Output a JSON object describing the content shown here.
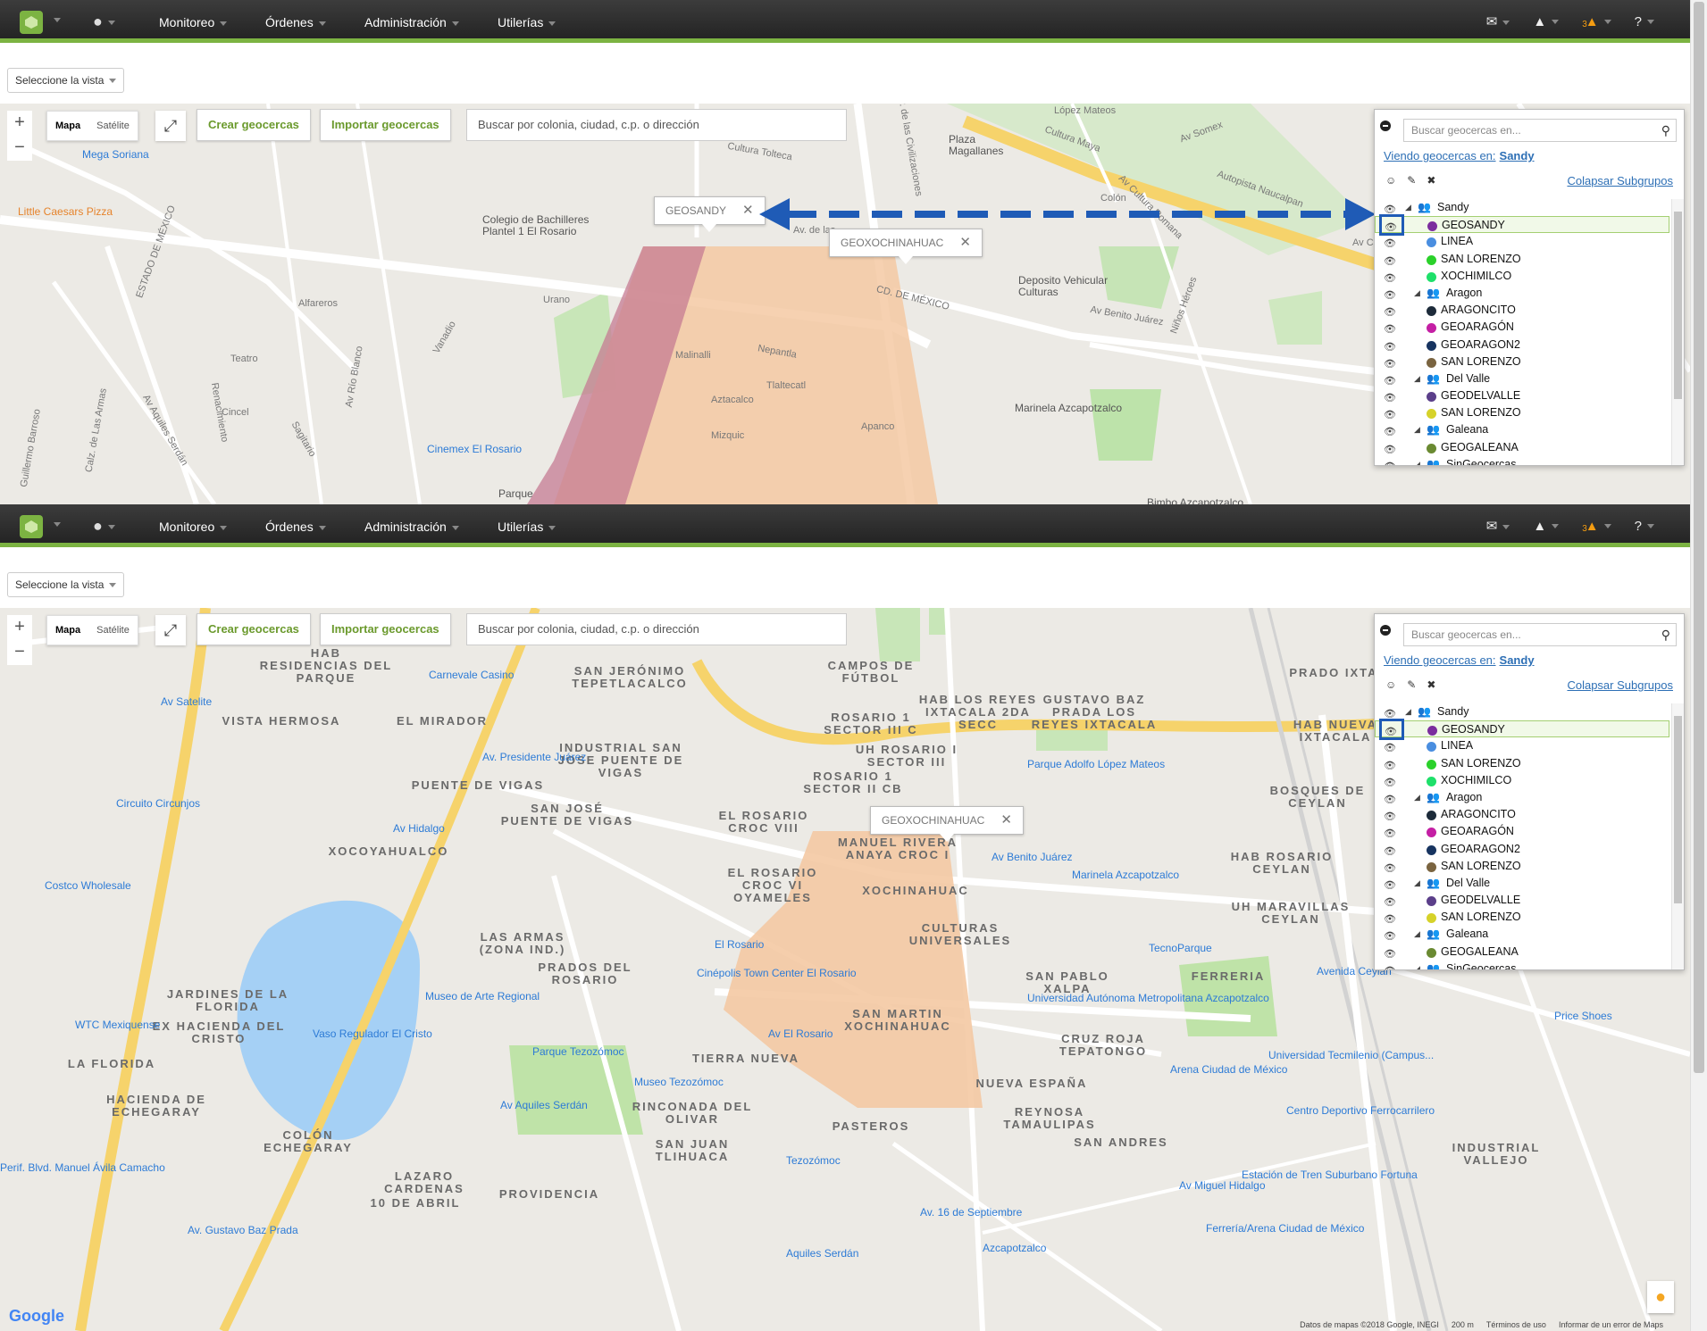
{
  "nav": {
    "menu": [
      "Monitoreo",
      "Órdenes",
      "Administración",
      "Utilerías"
    ],
    "alert_count": "3"
  },
  "view_select": "Seleccione la vista",
  "map_controls": {
    "map_label": "Mapa",
    "satellite_label": "Satélite",
    "create_label": "Crear geocercas",
    "import_label": "Importar geocercas",
    "search_placeholder": "Buscar por colonia, ciudad, c.p. o dirección"
  },
  "panel": {
    "search_placeholder": "Buscar geocercas en...",
    "viewing_label": "Viendo geocercas en:",
    "viewing_value": "Sandy",
    "collapse_label": "Colapsar Subgrupos",
    "tree": [
      {
        "type": "group",
        "label": "Sandy",
        "level": 0
      },
      {
        "type": "fence",
        "label": "GEOSANDY",
        "color": "#7b2d9e",
        "selected": true
      },
      {
        "type": "fence",
        "label": "LINEA",
        "color": "#4a8ee0"
      },
      {
        "type": "fence",
        "label": "SAN LORENZO",
        "color": "#2bd12b"
      },
      {
        "type": "fence",
        "label": "XOCHIMILCO",
        "color": "#1ee06a"
      },
      {
        "type": "group",
        "label": "Aragon",
        "level": 1
      },
      {
        "type": "fence",
        "label": "ARAGONCITO",
        "color": "#1d2b3a"
      },
      {
        "type": "fence",
        "label": "GEOARAGÓN",
        "color": "#c41fa4"
      },
      {
        "type": "fence",
        "label": "GEOARAGON2",
        "color": "#173460"
      },
      {
        "type": "fence",
        "label": "SAN LORENZO",
        "color": "#7a6440"
      },
      {
        "type": "group",
        "label": "Del Valle",
        "level": 1
      },
      {
        "type": "fence",
        "label": "GEODELVALLE",
        "color": "#5b3f8a"
      },
      {
        "type": "fence",
        "label": "SAN LORENZO",
        "color": "#d6d22a"
      },
      {
        "type": "group",
        "label": "Galeana",
        "level": 1
      },
      {
        "type": "fence",
        "label": "GEOGALEANA",
        "color": "#6a8a32"
      },
      {
        "type": "group",
        "label": "SinGeocercas",
        "level": 1
      }
    ]
  },
  "screen1": {
    "tips": [
      "GEOSANDY",
      "GEOXOCHINAHUAC"
    ],
    "labels": [
      "Mega Soriana",
      "Little Caesars Pizza",
      "Colegio de Bachilleres Plantel 1 El Rosario",
      "Plaza Magallanes",
      "López Mateos",
      "Autopista Naucalpan",
      "Deposito Vehicular Culturas",
      "Av Benito Juárez",
      "Marinela Azcapotzalco",
      "Cinemex El Rosario",
      "Bimbo Azcapotzalco",
      "Av. de las Civilizaciones",
      "CD. DE MÉXICO",
      "ESTADO DE MÉXICO",
      "Av Aquiles Serdán",
      "Calz. de Las Armas",
      "Av Cultura Romana",
      "Nepantla",
      "Tlaltecatl",
      "Malinalli",
      "Mizquic",
      "Aztacalco",
      "Apanco",
      "Urano",
      "Alfareros",
      "Teatro",
      "Cincel",
      "Vanadio",
      "Av Río Blanco",
      "Sagitario",
      "Guillermo Barroso",
      "Renacimiento",
      "Parque",
      "Colón",
      "Niños Héroes",
      "Av Cultura",
      "Av Somex",
      "Cultura Maya",
      "Cultura Tolteca",
      "Av. de las"
    ]
  },
  "screen2": {
    "tip": "GEOXOCHINAHUAC",
    "labels": [
      "HAB RESIDENCIAS DEL PARQUE",
      "VISTA HERMOSA",
      "EL MIRADOR",
      "PUENTE DE VIGAS",
      "XOCOYAHUALCO",
      "SAN JERÓNIMO TEPETLACALCO",
      "INDUSTRIAL SAN JOSE PUENTE DE VIGAS",
      "SAN JOSÉ PUENTE DE VIGAS",
      "ROSARIO 1 SECTOR III C",
      "UH ROSARIO I SECTOR III",
      "ROSARIO 1 SECTOR II CB",
      "EL ROSARIO CROC VIII",
      "MANUEL RIVERA ANAYA CROC I",
      "EL ROSARIO CROC VI OYAMELES",
      "XOCHINAHUAC",
      "CULTURAS UNIVERSALES",
      "SAN MARTIN XOCHINAHUAC",
      "LAS ARMAS (ZONA IND.)",
      "PRADOS DEL ROSARIO",
      "JARDINES DE LA FLORIDA",
      "EX HACIENDA DEL CRISTO",
      "LA FLORIDA",
      "HACIENDA DE ECHEGARAY",
      "COLÓN ECHEGARAY",
      "LAZARO CARDENAS",
      "10 DE ABRIL",
      "PROVIDENCIA",
      "TIERRA NUEVA",
      "RINCONADA DEL OLIVAR",
      "SAN JUAN TLIHUACA",
      "PASTEROS",
      "REYNOSA TAMAULIPAS",
      "SAN ANDRES",
      "NUEVA ESPAÑA",
      "CRUZ ROJA TEPATONGO",
      "SAN PABLO XALPA",
      "FERRERIA",
      "UH MARAVILLAS CEYLAN",
      "HAB ROSARIO CEYLAN",
      "BOSQUES DE CEYLAN",
      "HAB NUEVA IXTACALA",
      "PRADO IXTACALA",
      "GUSTAVO BAZ PRADA LOS REYES IXTACALA",
      "HAB LOS REYES IXTACALA 2DA SECC",
      "CAMPOS DE FÚTBOL",
      "INDUSTRIAL VALLEJO",
      "Carnevale Casino",
      "Parque Adolfo López Mateos",
      "Marinela Azcapotzalco",
      "TecnoParque",
      "Costco Wholesale",
      "WTC Mexiquense",
      "Museo de Arte Regional",
      "Parque Tezozómoc",
      "Museo Tezozómoc",
      "Cinépolis Town Center El Rosario",
      "El Rosario",
      "Universidad Autónoma Metropolitana Azcapotzalco",
      "Arena Ciudad de México",
      "Universidad Tecmilenio (Campus...",
      "Centro Deportivo Ferrocarrilero",
      "Price Shoes",
      "Estación de Tren Suburbano Fortuna",
      "Ferrería/Arena Ciudad de México",
      "Tezozómoc",
      "Aquiles Serdán",
      "Azcapotzalco",
      "Vaso Regulador El Cristo",
      "Perif. Blvd. Manuel Ávila Camacho",
      "Av. Gustavo Baz Prada",
      "Av Aquiles Serdán",
      "Av El Rosario",
      "Av. Presidente Juárez",
      "Av Benito Juárez",
      "Av Hidalgo",
      "Av. 16 de Septiembre",
      "Av Miguel Hidalgo",
      "Avenida Ceylán",
      "Av Satelite",
      "Circuito Circunjos"
    ],
    "footer": [
      "Datos de mapas ©2018 Google, INEGI",
      "200 m",
      "Términos de uso",
      "Informar de un error de Maps"
    ]
  }
}
